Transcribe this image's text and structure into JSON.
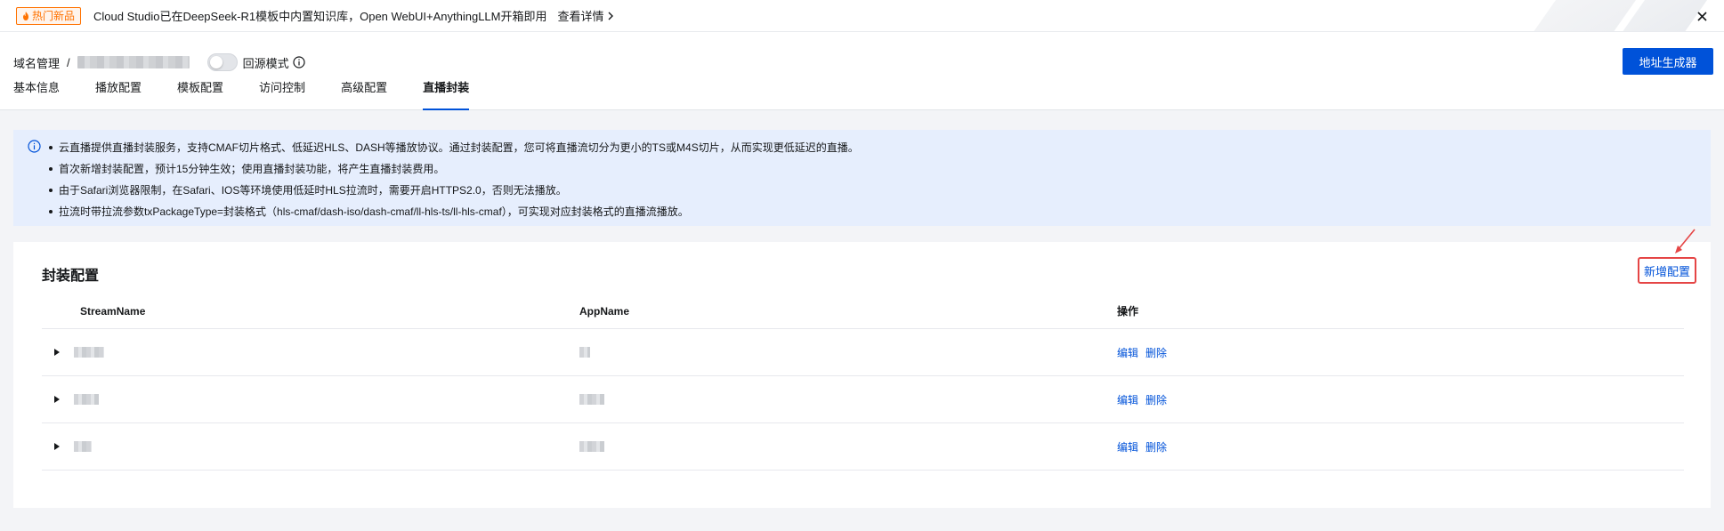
{
  "announcement": {
    "badge": "热门新品",
    "text": "Cloud Studio已在DeepSeek-R1模板中内置知识库，Open WebUI+AnythingLLM开箱即用",
    "link": "查看详情",
    "badge_color": "#ff7200"
  },
  "header": {
    "breadcrumb_root": "域名管理",
    "breadcrumb_sep": "/",
    "toggle_label": "回源模式",
    "generator_button": "地址生成器",
    "accent_color": "#0052d9"
  },
  "tabs": [
    {
      "label": "基本信息",
      "active": false
    },
    {
      "label": "播放配置",
      "active": false
    },
    {
      "label": "模板配置",
      "active": false
    },
    {
      "label": "访问控制",
      "active": false
    },
    {
      "label": "高级配置",
      "active": false
    },
    {
      "label": "直播封装",
      "active": true
    }
  ],
  "notice": {
    "items": [
      "云直播提供直播封装服务，支持CMAF切片格式、低延迟HLS、DASH等播放协议。通过封装配置，您可将直播流切分为更小的TS或M4S切片，从而实现更低延迟的直播。",
      "首次新增封装配置，预计15分钟生效；使用直播封装功能，将产生直播封装费用。",
      "由于Safari浏览器限制，在Safari、IOS等环境使用低延时HLS拉流时，需要开启HTTPS2.0，否则无法播放。",
      "拉流时带拉流参数txPackageType=封装格式（hls-cmaf/dash-iso/dash-cmaf/ll-hls-ts/ll-hls-cmaf），可实现对应封装格式的直播流播放。"
    ]
  },
  "card": {
    "title": "封装配置",
    "add_button": "新增配置",
    "highlight_color": "#e54545",
    "columns": [
      "StreamName",
      "AppName",
      "操作"
    ],
    "rows": [
      {
        "edit": "编辑",
        "delete": "删除"
      },
      {
        "edit": "编辑",
        "delete": "删除"
      },
      {
        "edit": "编辑",
        "delete": "删除"
      }
    ]
  }
}
